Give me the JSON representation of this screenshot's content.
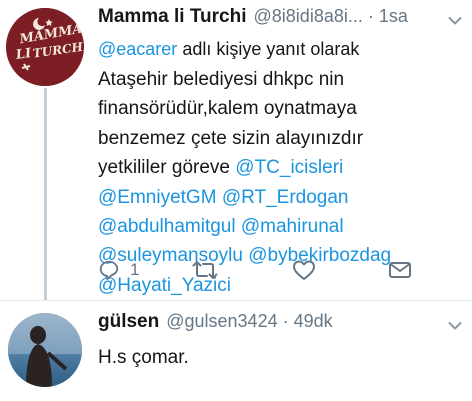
{
  "tweet1": {
    "avatar_text": [
      "MAMMA",
      "LI",
      "TURCHI!"
    ],
    "name": "Mamma li Turchi",
    "handle": "@8i8idi8a8i...",
    "time": "1sa",
    "reply_prefix_mention": "@eacarer",
    "reply_suffix": " adlı kişiye yanıt olarak",
    "body_text": "Ataşehir belediyesi dhkpc nin finansörüdür,kalem oynatmaya benzemez çete sizin alayınızdır yetkililer göreve",
    "mentions": [
      "@TC_icisleri",
      "@EmniyetGM",
      "@RT_Erdogan",
      "@abdulhamitgul",
      "@mahirunal",
      "@suleymansoylu",
      "@bybekirbozdag",
      "@Hayati_Yazici"
    ],
    "reply_count": "1"
  },
  "tweet2": {
    "name": "gülsen",
    "handle": "@gulsen3424",
    "time": "49dk",
    "body_text": "H.s çomar."
  },
  "separator": "·",
  "icons": [
    "reply-icon",
    "retweet-icon",
    "like-icon",
    "dm-icon",
    "chevron-down-icon"
  ],
  "colors": {
    "link": "#1b95e0",
    "muted": "#657786",
    "avatar_bg": "#7d1d24",
    "thread_line": "#c4cfd6"
  }
}
